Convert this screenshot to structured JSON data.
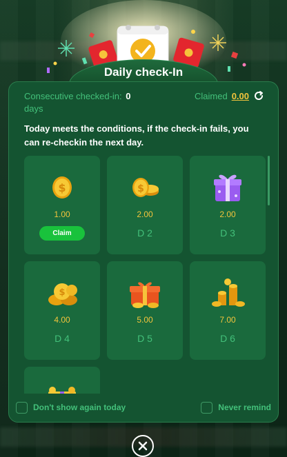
{
  "dialog": {
    "title": "Daily check-In",
    "consecutive_label": "Consecutive checked-in:",
    "consecutive_value": "0",
    "consecutive_unit": "days",
    "claimed_label": "Claimed",
    "claimed_value": "0.00",
    "notice": "Today meets the conditions, if the check-in fails, you can re-checkin the next day."
  },
  "days": [
    {
      "amount": "1.00",
      "day_label": "",
      "action_label": "Claim",
      "icon": "coin-icon"
    },
    {
      "amount": "2.00",
      "day_label": "D 2",
      "icon": "coins-stack-icon"
    },
    {
      "amount": "2.00",
      "day_label": "D 3",
      "icon": "purple-gift-icon"
    },
    {
      "amount": "4.00",
      "day_label": "D 4",
      "icon": "coin-pile-icon"
    },
    {
      "amount": "5.00",
      "day_label": "D 5",
      "icon": "treasure-box-icon"
    },
    {
      "amount": "7.00",
      "day_label": "D 6",
      "icon": "coin-tower-icon"
    },
    {
      "amount": "",
      "day_label": "",
      "icon": "gold-gift-icon"
    }
  ],
  "footer": {
    "dont_show_label": "Don't show again today",
    "never_remind_label": "Never remind"
  },
  "colors": {
    "panel": "#145431",
    "card": "#1a6a3d",
    "accent_green": "#43c07a",
    "gold": "#f2c43c",
    "claim_button": "#19c23c"
  }
}
